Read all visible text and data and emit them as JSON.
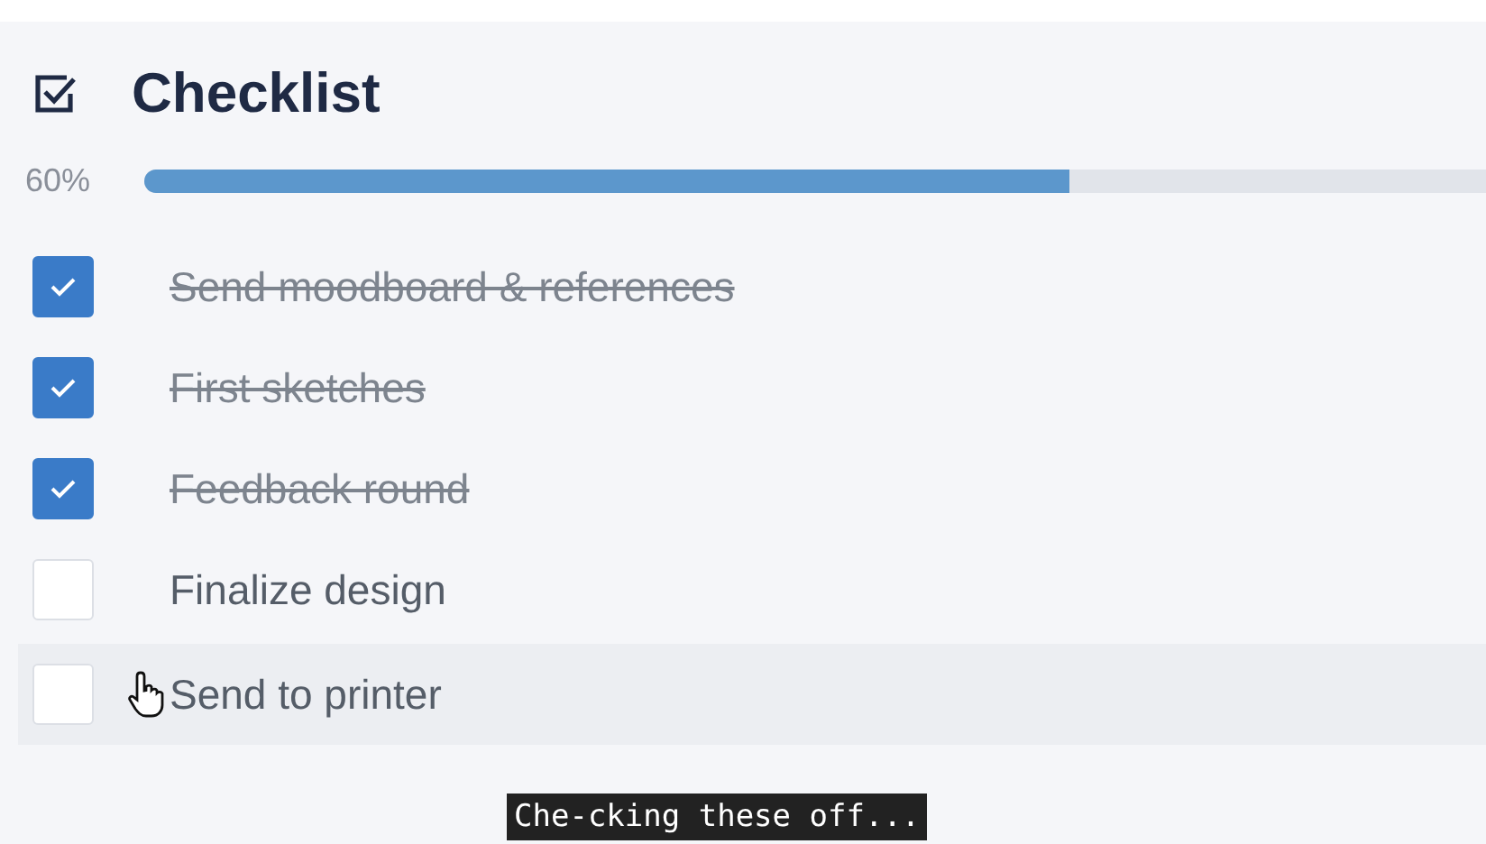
{
  "title": "Checklist",
  "progress": {
    "reading": "60%",
    "level": 0.69
  },
  "items": [
    {
      "label": "Send moodboard & references",
      "checked": true,
      "hovered": false
    },
    {
      "label": "First sketches",
      "checked": true,
      "hovered": false
    },
    {
      "label": "Feedback round",
      "checked": true,
      "hovered": false
    },
    {
      "label": "Finalize design",
      "checked": false,
      "hovered": false
    },
    {
      "label": "Send to printer",
      "checked": false,
      "hovered": true
    }
  ],
  "caption": "Che-cking these off..."
}
